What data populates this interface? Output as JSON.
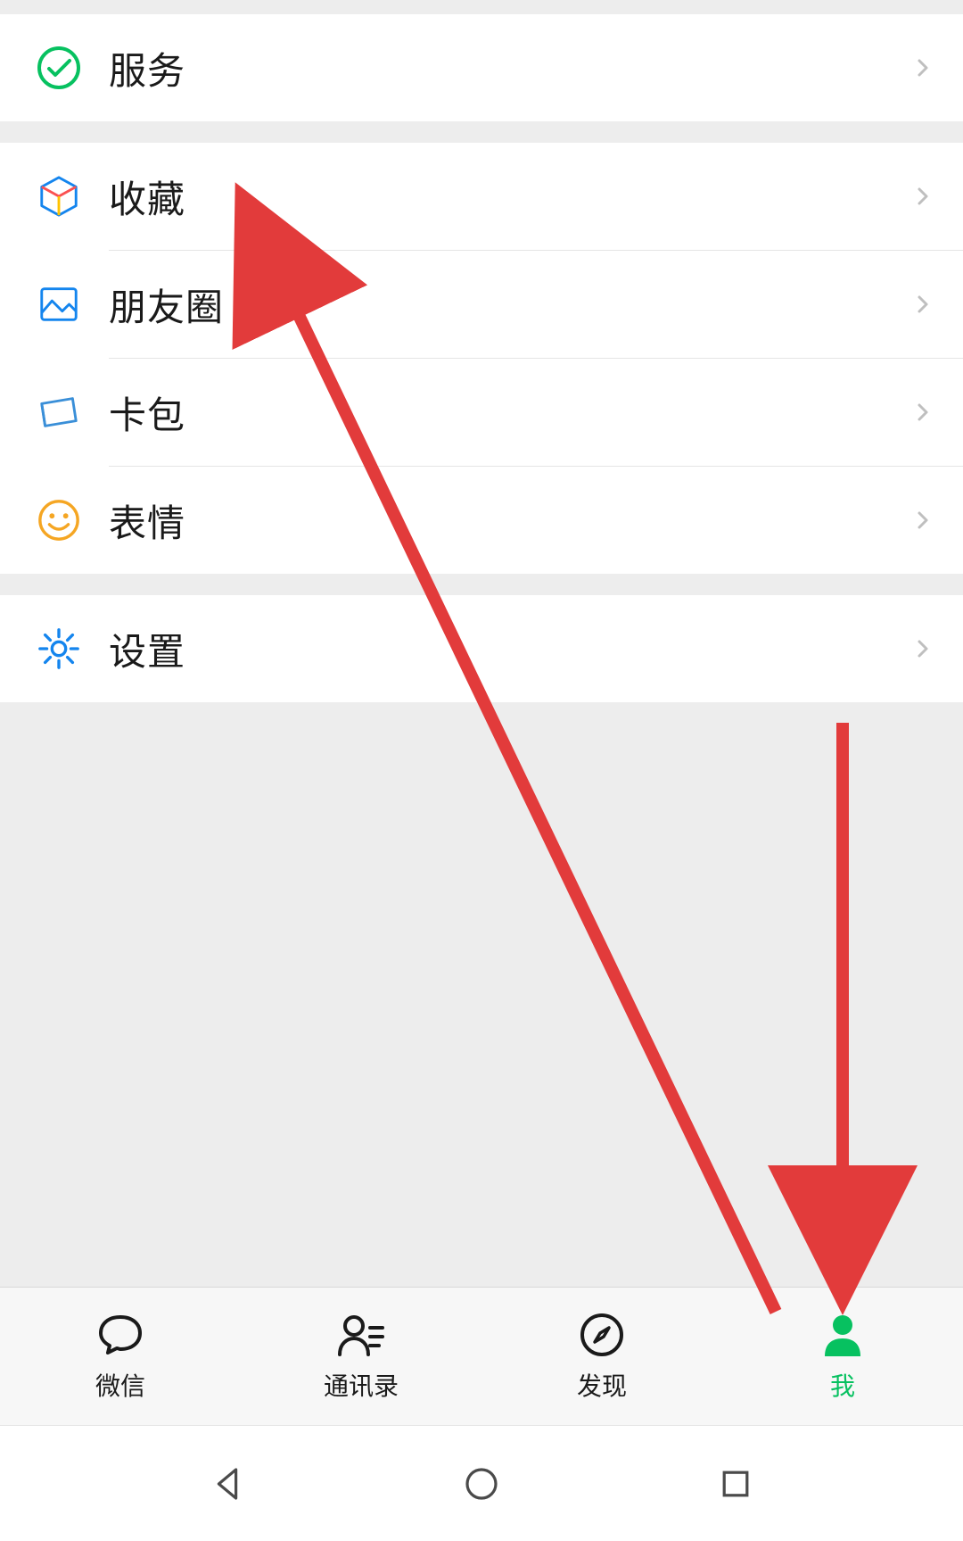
{
  "colors": {
    "accent": "#07C160",
    "arrow": "#E23B3B",
    "link_blue": "#1485EE",
    "card_blue": "#3A8FD8",
    "emoji_yellow": "#F5A623",
    "settings_blue": "#1485EE"
  },
  "sections": [
    {
      "items": [
        {
          "id": "services",
          "label": "服务",
          "icon": "services-icon"
        }
      ]
    },
    {
      "items": [
        {
          "id": "favorites",
          "label": "收藏",
          "icon": "favorites-icon"
        },
        {
          "id": "moments",
          "label": "朋友圈",
          "icon": "moments-icon"
        },
        {
          "id": "cards",
          "label": "卡包",
          "icon": "cards-icon"
        },
        {
          "id": "stickers",
          "label": "表情",
          "icon": "stickers-icon"
        }
      ]
    },
    {
      "items": [
        {
          "id": "settings",
          "label": "设置",
          "icon": "settings-icon"
        }
      ]
    }
  ],
  "tabs": [
    {
      "id": "chats",
      "label": "微信",
      "active": false
    },
    {
      "id": "contacts",
      "label": "通讯录",
      "active": false
    },
    {
      "id": "discover",
      "label": "发现",
      "active": false
    },
    {
      "id": "me",
      "label": "我",
      "active": true
    }
  ],
  "annotations": {
    "arrow1": {
      "from": "tab-me",
      "to": "row-favorites"
    },
    "arrow2": {
      "from": "above-tab-me",
      "to": "tab-me"
    }
  }
}
